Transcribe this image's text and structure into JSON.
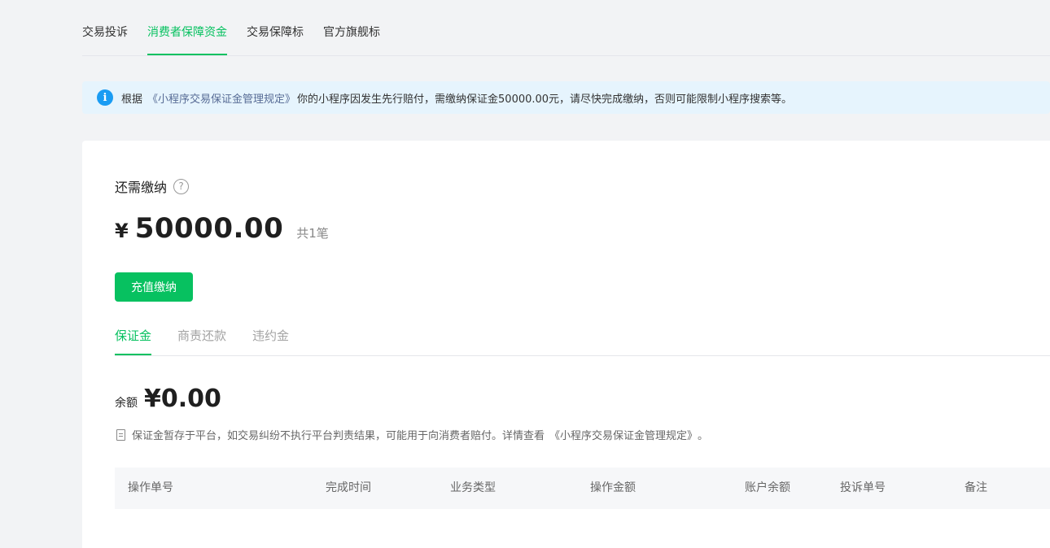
{
  "top_tabs": [
    {
      "label": "交易投诉"
    },
    {
      "label": "消费者保障资金"
    },
    {
      "label": "交易保障标"
    },
    {
      "label": "官方旗舰标"
    }
  ],
  "notice": {
    "icon": "info-icon",
    "prefix": "根据",
    "link": "《小程序交易保证金管理规定》",
    "text": "你的小程序因发生先行赔付，需缴纳保证金50000.00元，请尽快完成缴纳，否则可能限制小程序搜索等。"
  },
  "due": {
    "label": "还需缴纳",
    "help_icon": "question-icon",
    "currency": "¥",
    "amount": "50000.00",
    "count": "共1笔"
  },
  "pay_button": {
    "label": "充值缴纳"
  },
  "sub_tabs": [
    {
      "label": "保证金"
    },
    {
      "label": "商责还款"
    },
    {
      "label": "违约金"
    }
  ],
  "balance": {
    "label": "余额",
    "value": "¥0.00"
  },
  "balance_note": {
    "icon": "document-icon",
    "text": "保证金暂存于平台，如交易纠纷不执行平台判责结果，可能用于向消费者赔付。详情查看",
    "link": "《小程序交易保证金管理规定》",
    "suffix": "。"
  },
  "table": {
    "columns": [
      "操作单号",
      "完成时间",
      "业务类型",
      "操作金额",
      "账户余额",
      "投诉单号",
      "备注"
    ]
  },
  "colors": {
    "accent": "#07c160",
    "info": "#1a9cf3",
    "link": "#576b95"
  }
}
